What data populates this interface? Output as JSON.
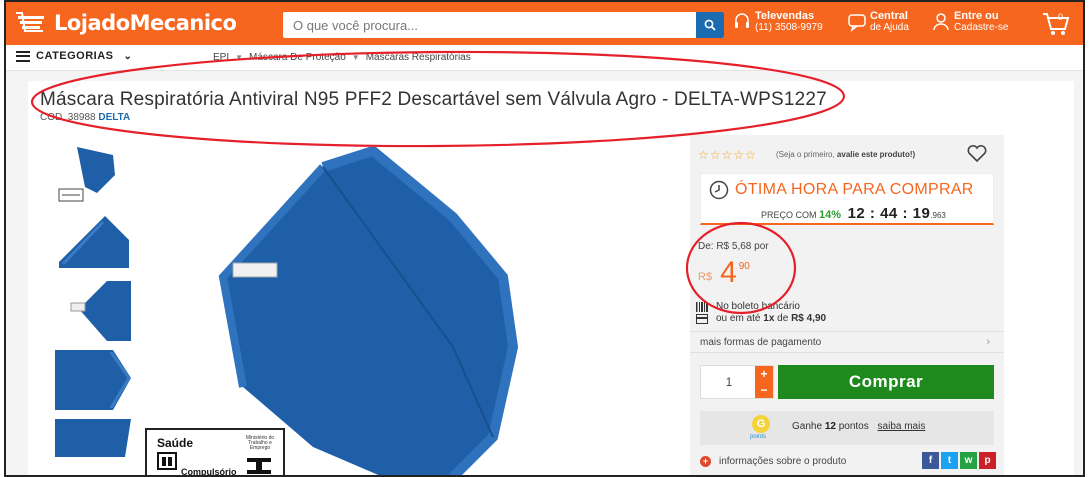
{
  "header": {
    "logo_text": "LojadoMecanico",
    "search_placeholder": "O que você procura...",
    "televendas_title": "Televendas",
    "televendas_phone": "(11) 3508-9979",
    "central_title": "Central",
    "central_sub": "de Ajuda",
    "login_title": "Entre ou",
    "login_sub": "Cadastre-se",
    "cart_count": "0",
    "brand_color": "#f6661f"
  },
  "catbar": {
    "categories_label": "CATEGORIAS",
    "breadcrumbs": [
      "EPI",
      "Máscara De Proteção",
      "Máscaras Respiratórias"
    ]
  },
  "product": {
    "title": "Máscara Respiratória Antiviral N95 PFF2 Descartável sem Válvula Agro - DELTA-WPS1227",
    "code_label": "COD. 38988",
    "brand": "DELTA",
    "seal_title": "Saúde",
    "seal_sub": "Compulsório",
    "seal_ministry": "Ministério do Trabalho e Emprego",
    "seal_inmetro": "INMETRO"
  },
  "panel": {
    "stars": "☆☆☆☆☆",
    "rating_text_prefix": "(Seja o primeiro,",
    "rating_text_bold": "avalie este produto!)",
    "hour_title": "ÓTIMA HORA PARA COMPRAR",
    "hour_prefix": "PREÇO COM",
    "hour_pct": "14%",
    "hour_timer": "12 : 44 : 19",
    "hour_ms": ".963",
    "de_price": "De: R$ 5,68 por",
    "currency": "R$",
    "price_int": "4",
    "price_dec": "90",
    "boleto": "No boleto bancário",
    "installment_prefix": "ou em até",
    "installment_bold1": "1x",
    "installment_mid": "de",
    "installment_bold2": "R$ 4,90",
    "more_payment": "mais formas de pagamento",
    "quantity": "1",
    "buy_label": "Comprar",
    "points_prefix": "Ganhe",
    "points_value": "12",
    "points_suffix": "pontos",
    "points_more": "saiba mais",
    "points_brand": "points",
    "info_label": "informações sobre o produto"
  },
  "colors": {
    "accent": "#f6661f",
    "buy_green": "#1e8a1e",
    "link_blue": "#1b6bb0",
    "annotation_red": "#e5202a"
  }
}
